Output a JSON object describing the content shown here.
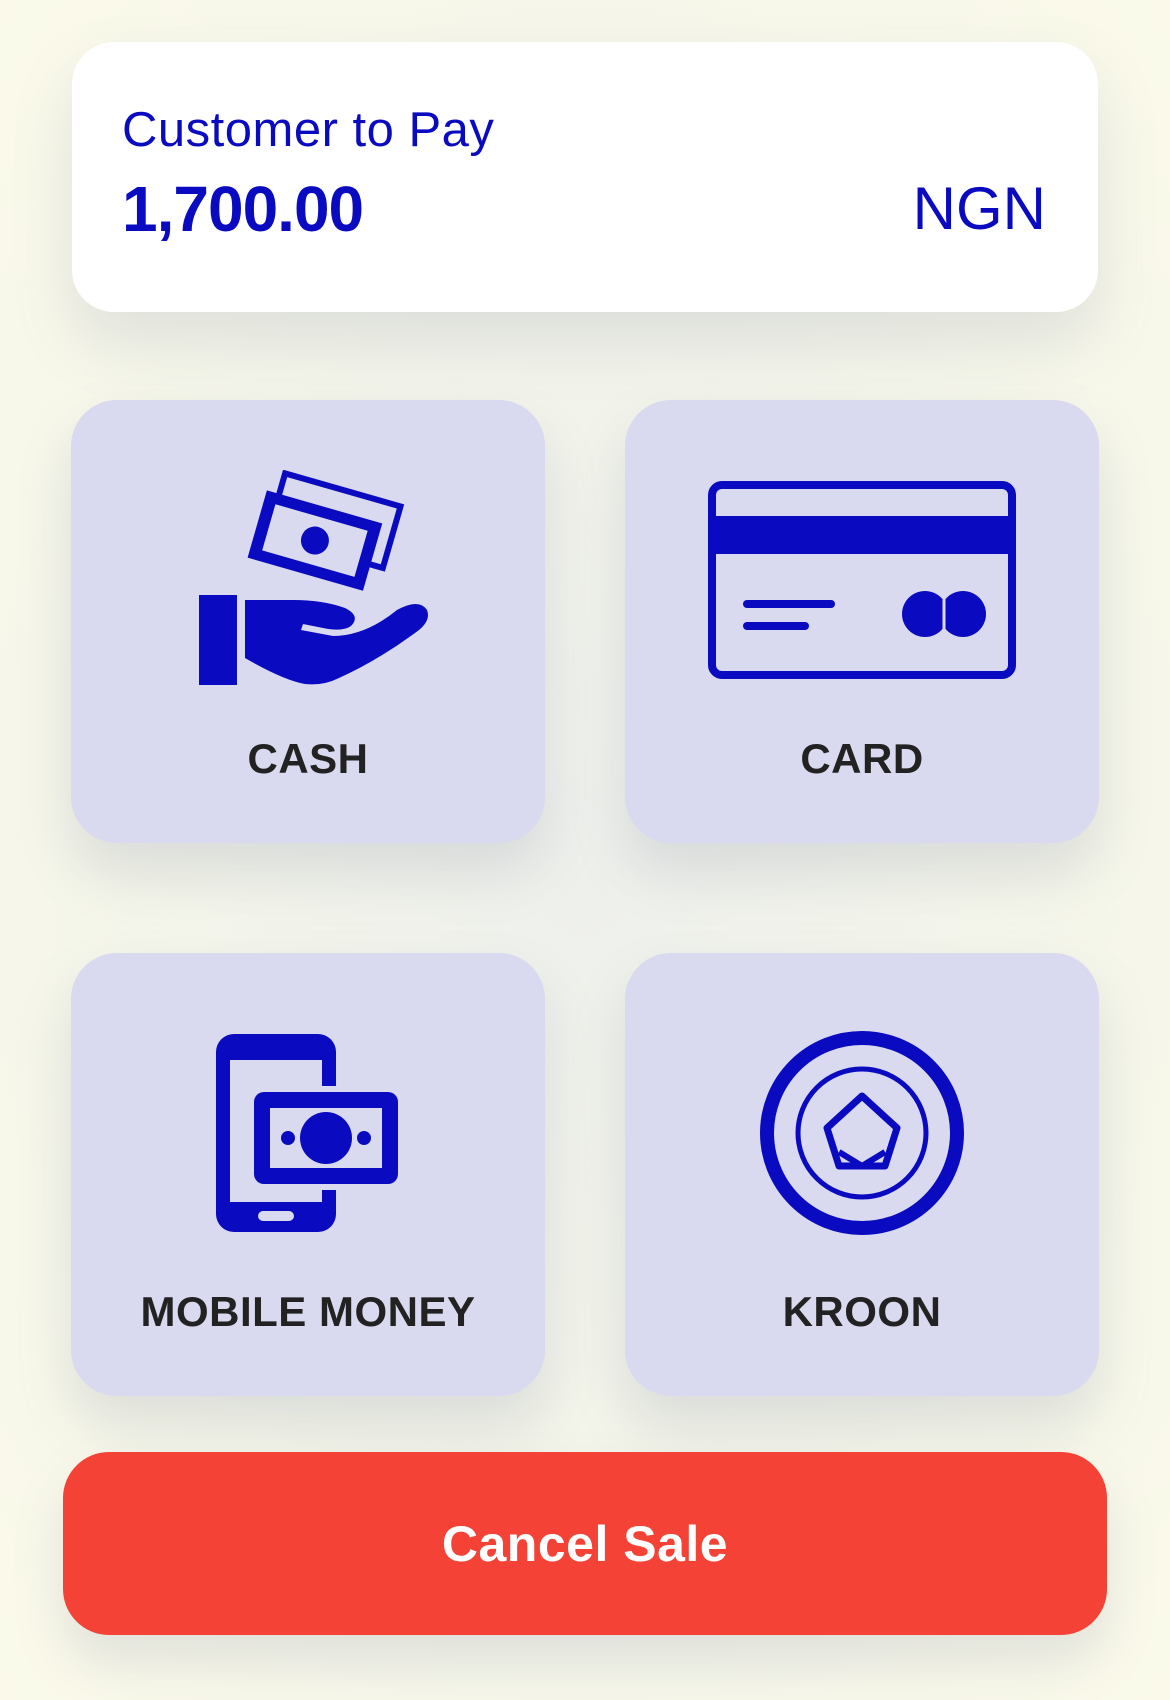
{
  "payment": {
    "label": "Customer to Pay",
    "amount": "1,700.00",
    "currency": "NGN"
  },
  "methods": [
    {
      "label": "CASH",
      "icon": "cash-hand-icon"
    },
    {
      "label": "CARD",
      "icon": "credit-card-icon"
    },
    {
      "label": "MOBILE MONEY",
      "icon": "mobile-money-icon"
    },
    {
      "label": "KROON",
      "icon": "kroon-coin-icon"
    }
  ],
  "actions": {
    "cancel_label": "Cancel Sale"
  },
  "colors": {
    "accent": "#0a0ac0",
    "tile_bg": "#d9d9ef",
    "cancel": "#f44336"
  }
}
